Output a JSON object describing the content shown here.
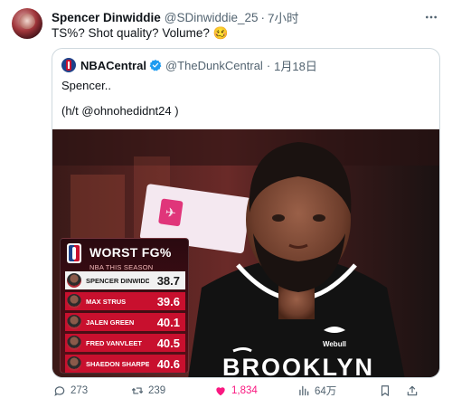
{
  "tweet": {
    "display_name": "Spencer Dinwiddie",
    "handle": "@SDinwiddie_25",
    "separator": "·",
    "time": "7小时",
    "text": "TS%? Shot quality? Volume? 🥴"
  },
  "quote": {
    "name": "NBACentral",
    "handle": "@TheDunkCentral",
    "separator": "·",
    "date": "1月18日",
    "line1": "Spencer..",
    "line2": "(h/t @ohnohedidnt24 )"
  },
  "stats_card": {
    "title": "WORST FG%",
    "subtitle": "NBA THIS SEASON",
    "rows": [
      {
        "name": "SPENCER DINWIDDIE",
        "value": "38.7"
      },
      {
        "name": "MAX STRUS",
        "value": "39.6"
      },
      {
        "name": "JALEN GREEN",
        "value": "40.1"
      },
      {
        "name": "FRED VANVLEET",
        "value": "40.5"
      },
      {
        "name": "SHAEDON SHARPE",
        "value": "40.6"
      }
    ]
  },
  "jersey": {
    "team_text": "BROOKLYN",
    "sponsor": "Webull"
  },
  "actions": {
    "replies": "273",
    "retweets": "239",
    "likes": "1,834",
    "views": "64万"
  },
  "colors": {
    "like": "#f91880",
    "secondary_text": "#536471",
    "card_red": "#c8102e"
  }
}
